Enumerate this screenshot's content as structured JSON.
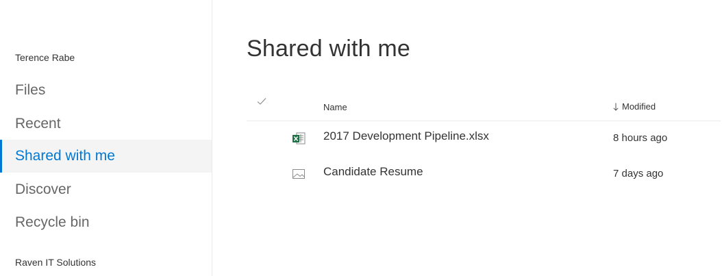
{
  "sidebar": {
    "user_name": "Terence Rabe",
    "items": [
      {
        "label": "Files",
        "selected": false
      },
      {
        "label": "Recent",
        "selected": false
      },
      {
        "label": "Shared with me",
        "selected": true
      },
      {
        "label": "Discover",
        "selected": false
      },
      {
        "label": "Recycle bin",
        "selected": false
      }
    ],
    "org_name": "Raven IT Solutions"
  },
  "main": {
    "title": "Shared with me",
    "columns": {
      "select_icon": "checkmark-icon",
      "name": "Name",
      "modified": "Modified",
      "sort_icon": "sort-down-arrow-icon"
    },
    "files": [
      {
        "name": "2017 Development Pipeline.xlsx",
        "modified": "8 hours ago",
        "icon": "excel-file-icon"
      },
      {
        "name": "Candidate Resume",
        "modified": "7 days ago",
        "icon": "image-file-icon"
      }
    ]
  },
  "colors": {
    "accent": "#0078d4",
    "selected_bg": "#f4f4f4",
    "excel_green": "#1e7145"
  }
}
